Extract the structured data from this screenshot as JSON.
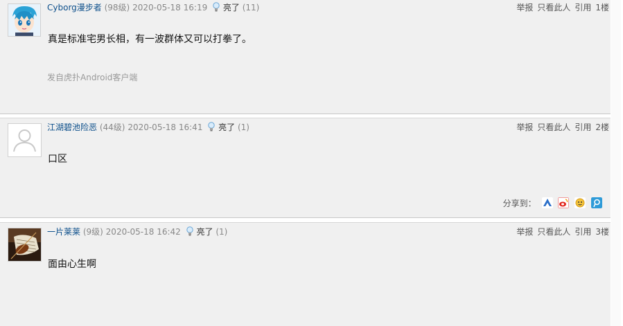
{
  "posts": [
    {
      "username": "Cyborg漫步者",
      "level": "(98级)",
      "time": "2020-05-18 16:19",
      "light_label": "亮了",
      "light_count": "(11)",
      "report": "举报",
      "only_this": "只看此人",
      "quote": "引用",
      "floor": "1楼",
      "content": "真是标准宅男长相，有一波群体又可以打拳了。",
      "source": "发自虎扑Android客户端"
    },
    {
      "username": "江湖碧池险恶",
      "level": "(44级)",
      "time": "2020-05-18 16:41",
      "light_label": "亮了",
      "light_count": "(1)",
      "report": "举报",
      "only_this": "只看此人",
      "quote": "引用",
      "floor": "2楼",
      "content": "口区",
      "share_label": "分享到："
    },
    {
      "username": "一片莱莱",
      "level": "(9级)",
      "time": "2020-05-18 16:42",
      "light_label": "亮了",
      "light_count": "(1)",
      "report": "举报",
      "only_this": "只看此人",
      "quote": "引用",
      "floor": "3楼",
      "content": "面由心生啊"
    }
  ],
  "share_icons": [
    "baidu-icon",
    "weibo-icon",
    "qzone-icon",
    "tencent-weibo-icon"
  ],
  "colors": {
    "username": "#0d4f8b",
    "meta_gray": "#888888",
    "post_bg": "#f0f0f0"
  }
}
